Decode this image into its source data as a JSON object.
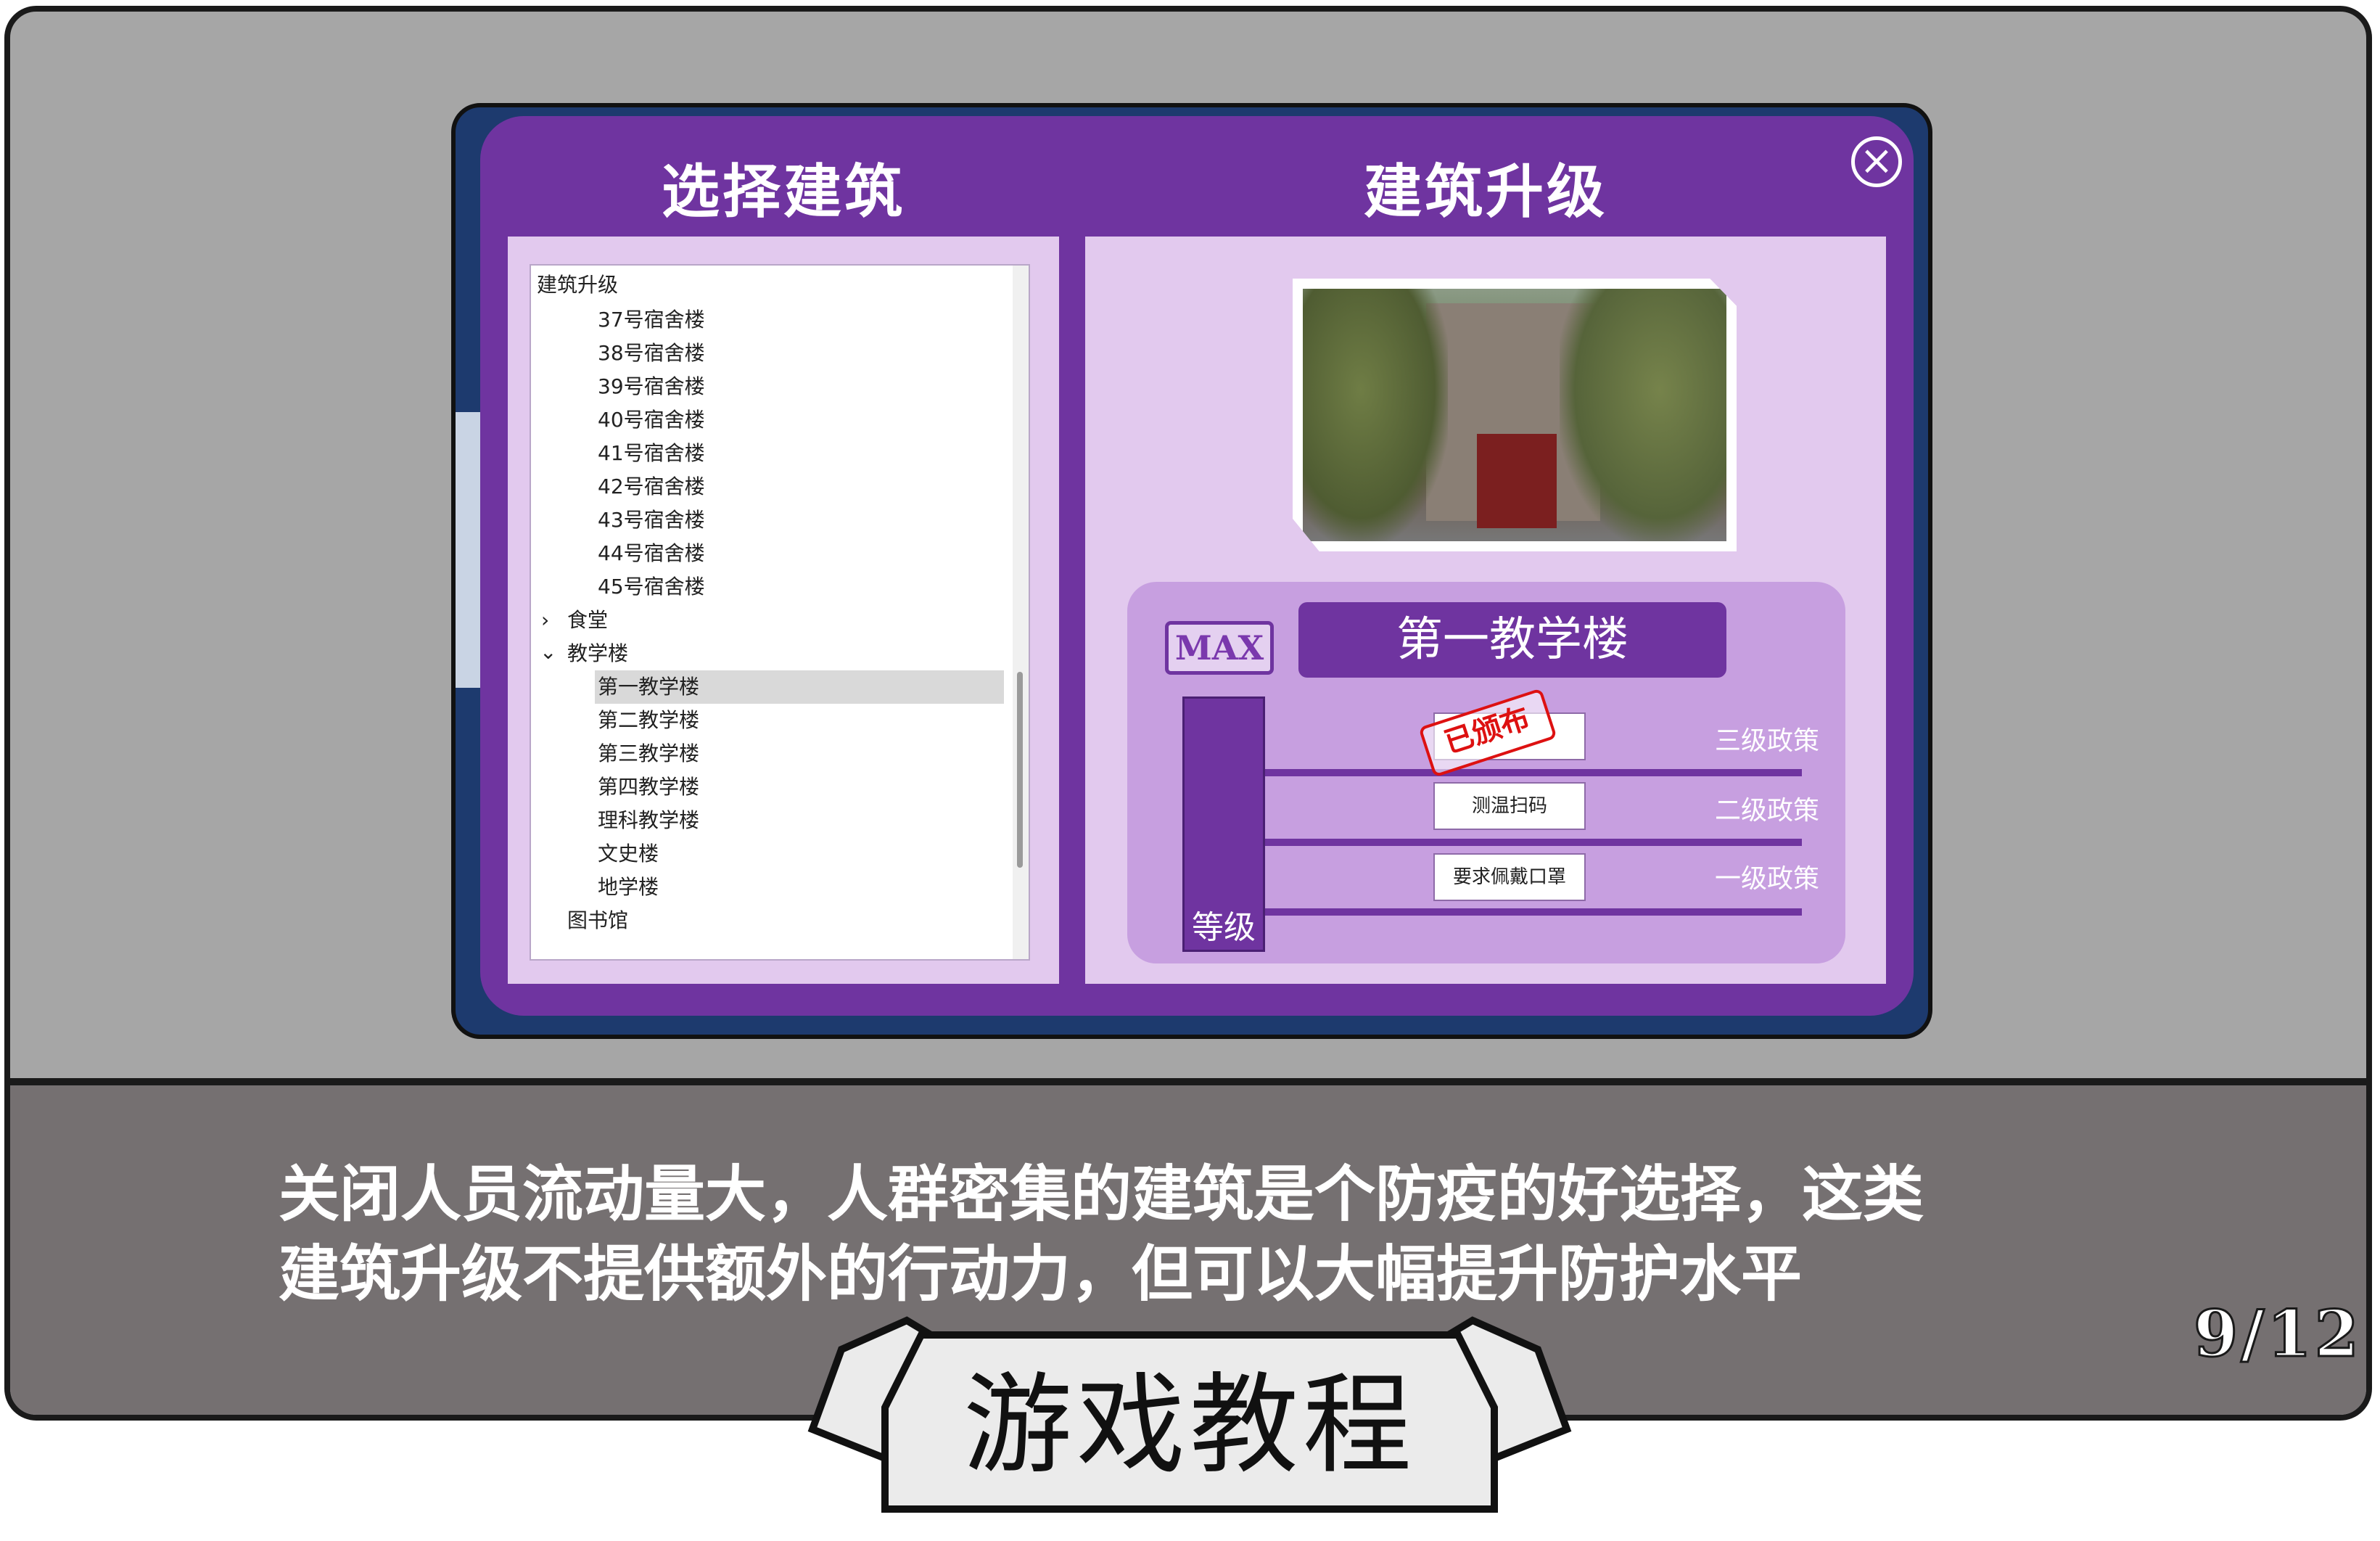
{
  "dialog": {
    "left_title": "选择建筑",
    "right_title": "建筑升级",
    "close_icon": "close-icon"
  },
  "tree": {
    "root_label": "建筑升级",
    "dorm_items": [
      "37号宿舍楼",
      "38号宿舍楼",
      "39号宿舍楼",
      "40号宿舍楼",
      "41号宿舍楼",
      "42号宿舍楼",
      "43号宿舍楼",
      "44号宿舍楼",
      "45号宿舍楼"
    ],
    "canteen_label": "食堂",
    "canteen_toggle": "›",
    "teaching_label": "教学楼",
    "teaching_toggle": "⌄",
    "teaching_items": [
      "第一教学楼",
      "第二教学楼",
      "第三教学楼",
      "第四教学楼",
      "理科教学楼",
      "文史楼",
      "地学楼"
    ],
    "library_label": "图书馆",
    "selected_item": "第一教学楼"
  },
  "upgrade": {
    "max_badge": "MAX",
    "building_name": "第一教学楼",
    "level_label": "等级",
    "stamp_text": "已颁布",
    "policies": [
      {
        "button": "",
        "tier": "三级政策"
      },
      {
        "button": "测温扫码",
        "tier": "二级政策"
      },
      {
        "button": "要求佩戴口罩",
        "tier": "一级政策"
      }
    ]
  },
  "caption": {
    "line1": "关闭人员流动量大，人群密集的建筑是个防疫的好选择，这类",
    "line2": "建筑升级不提供额外的行动力，但可以大幅提升防护水平"
  },
  "page_indicator": "9/12",
  "title_plate": "游戏教程",
  "colors": {
    "accent": "#6f34a0",
    "panel": "#e2c9ee",
    "band": "#757071",
    "frame": "#a6a6a6"
  }
}
